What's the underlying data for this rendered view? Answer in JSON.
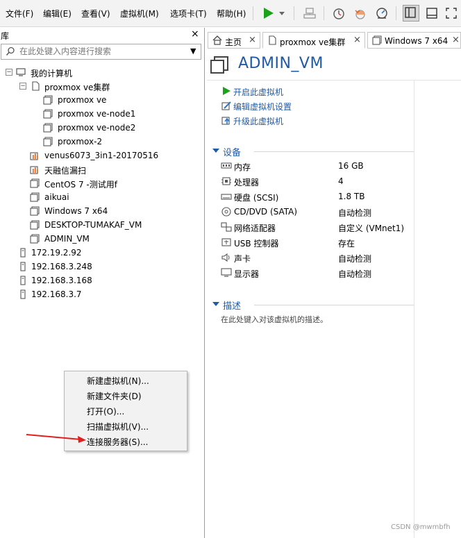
{
  "menubar": {
    "items": [
      "文件(F)",
      "编辑(E)",
      "查看(V)",
      "虚拟机(M)",
      "选项卡(T)",
      "帮助(H)"
    ]
  },
  "toolbar": {
    "icons": [
      "play-icon",
      "dropdown-icon",
      "send-keys-icon",
      "snapshot-icon",
      "revert-snapshot-icon",
      "snapshot-manager-icon",
      "library-view-icon",
      "console-view-icon",
      "fullscreen-icon"
    ],
    "accent": "#1aa31a"
  },
  "library": {
    "title": "库",
    "close": "×",
    "search_placeholder": "在此处键入内容进行搜索",
    "tree": [
      {
        "label": "我的计算机",
        "icon": "computer-icon",
        "expander": "−"
      },
      {
        "label": "proxmox ve集群",
        "icon": "folder-icon",
        "expander": "−"
      },
      {
        "label": "proxmox ve",
        "icon": "vm-icon"
      },
      {
        "label": "proxmox ve-node1",
        "icon": "vm-icon"
      },
      {
        "label": "proxmox ve-node2",
        "icon": "vm-icon"
      },
      {
        "label": "proxmox-2",
        "icon": "vm-icon"
      },
      {
        "label": "venus6073_3in1-20170516",
        "icon": "vm-running-icon"
      },
      {
        "label": "天融信漏扫",
        "icon": "vm-running-icon"
      },
      {
        "label": "CentOS 7 -测试用f",
        "icon": "vm-icon"
      },
      {
        "label": "aikuai",
        "icon": "vm-icon"
      },
      {
        "label": "Windows 7 x64",
        "icon": "vm-icon"
      },
      {
        "label": "DESKTOP-TUMAKAF_VM",
        "icon": "vm-icon"
      },
      {
        "label": "ADMIN_VM",
        "icon": "vm-icon"
      },
      {
        "label": "172.19.2.92",
        "icon": "server-icon"
      },
      {
        "label": "192.168.3.248",
        "icon": "server-icon"
      },
      {
        "label": "192.168.3.168",
        "icon": "server-icon"
      },
      {
        "label": "192.168.3.7",
        "icon": "server-icon"
      }
    ]
  },
  "tabs": [
    {
      "label": "主页",
      "close": "×"
    },
    {
      "label": "proxmox ve集群",
      "close": "×"
    },
    {
      "label": "Windows 7 x64",
      "close": "×"
    }
  ],
  "vm": {
    "title": "ADMIN_VM",
    "actions": [
      "开启此虚拟机",
      "编辑虚拟机设置",
      "升级此虚拟机"
    ],
    "devices_section": "设备",
    "devices": [
      {
        "name": "内存",
        "value": "16 GB",
        "icon": "memory-icon"
      },
      {
        "name": "处理器",
        "value": "4",
        "icon": "cpu-icon"
      },
      {
        "name": "硬盘 (SCSI)",
        "value": "1.8 TB",
        "icon": "harddisk-icon"
      },
      {
        "name": "CD/DVD (SATA)",
        "value": "自动检测",
        "icon": "cd-icon"
      },
      {
        "name": "网络适配器",
        "value": "自定义 (VMnet1)",
        "icon": "network-icon"
      },
      {
        "name": "USB 控制器",
        "value": "存在",
        "icon": "usb-icon"
      },
      {
        "name": "声卡",
        "value": "自动检测",
        "icon": "sound-icon"
      },
      {
        "name": "显示器",
        "value": "自动检测",
        "icon": "display-icon"
      }
    ],
    "description_section": "描述",
    "description_placeholder": "在此处键入对该虚拟机的描述。"
  },
  "context_menu": {
    "items": [
      "新建虚拟机(N)...",
      "新建文件夹(D)",
      "打开(O)...",
      "扫描虚拟机(V)...",
      "连接服务器(S)..."
    ]
  },
  "annotation": {
    "arrow_color": "#e02020"
  },
  "watermark": "CSDN @mwmbfh"
}
